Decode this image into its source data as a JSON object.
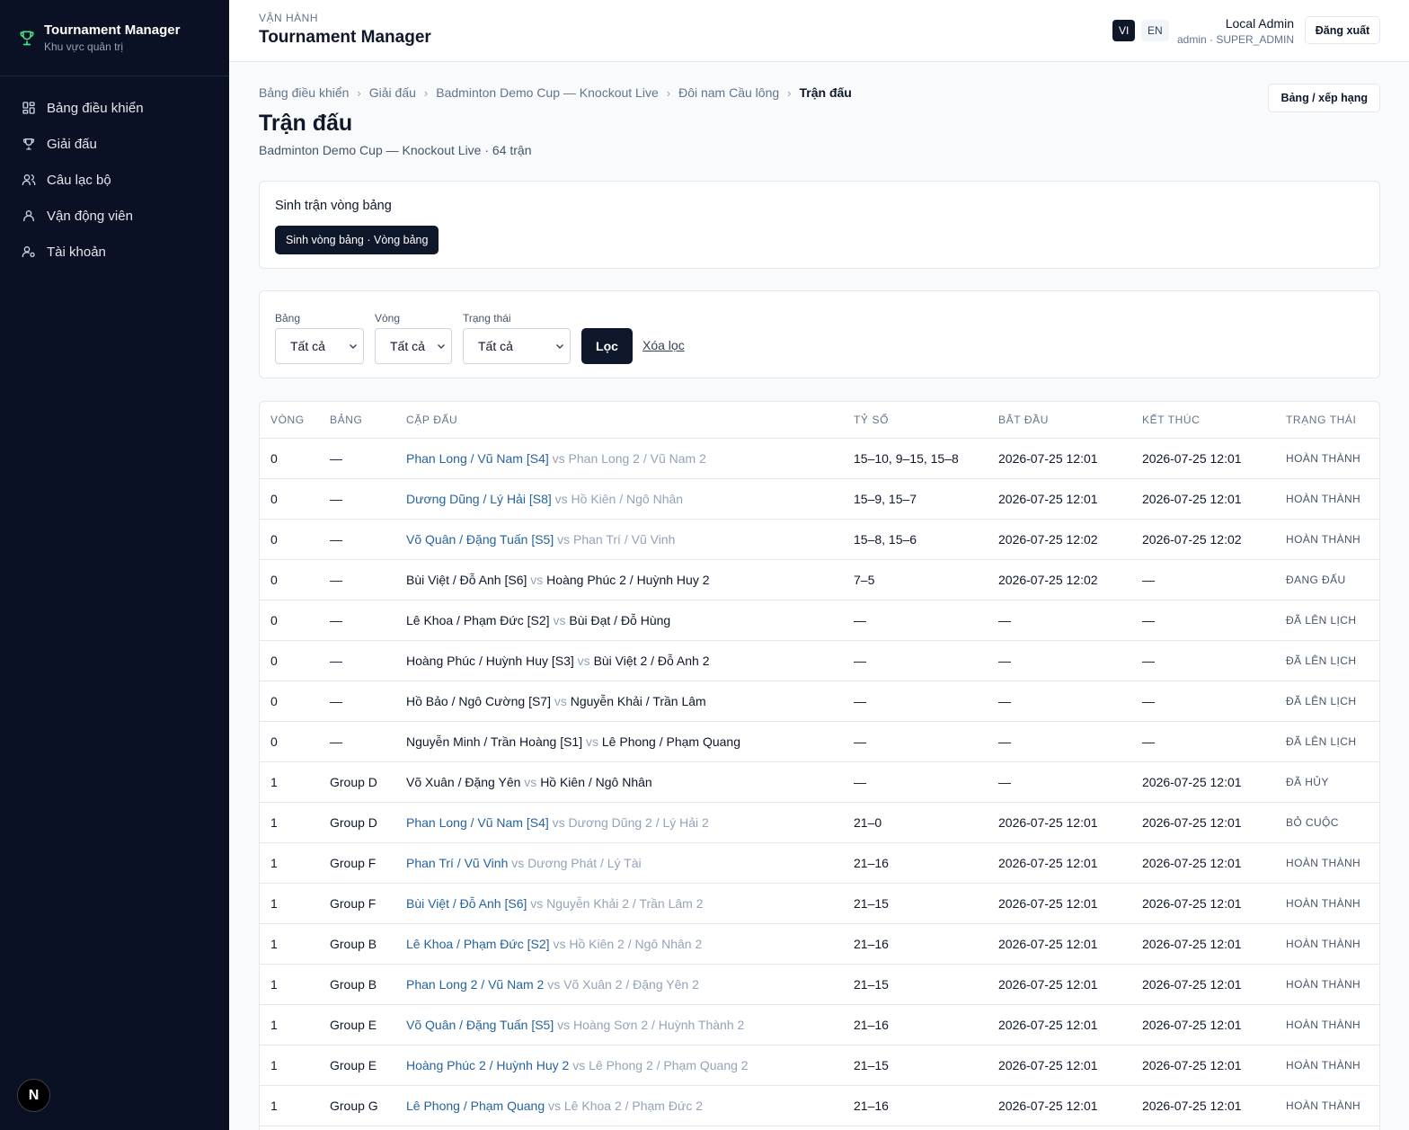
{
  "brand": {
    "title": "Tournament Manager",
    "subtitle": "Khu vực quản trị"
  },
  "nav": [
    {
      "label": "Bảng điều khiển",
      "icon": "dashboard-icon"
    },
    {
      "label": "Giải đấu",
      "icon": "trophy-icon"
    },
    {
      "label": "Câu lạc bộ",
      "icon": "users-icon"
    },
    {
      "label": "Vận động viên",
      "icon": "user-icon"
    },
    {
      "label": "Tài khoản",
      "icon": "user-cog-icon"
    }
  ],
  "header": {
    "eyebrow": "VẬN HÀNH",
    "title": "Tournament Manager",
    "lang_vi": "VI",
    "lang_en": "EN",
    "user_name": "Local Admin",
    "user_role": "admin · SUPER_ADMIN",
    "logout": "Đăng xuất"
  },
  "breadcrumb": [
    "Bảng điều khiển",
    "Giải đấu",
    "Badminton Demo Cup — Knockout Live",
    "Đôi nam Cầu lông",
    "Trận đấu"
  ],
  "page": {
    "title": "Trận đấu",
    "subtitle": "Badminton Demo Cup — Knockout Live · 64 trận",
    "ranking_button": "Bảng / xếp hạng"
  },
  "generate": {
    "title": "Sinh trận vòng bảng",
    "button": "Sinh vòng bảng · Vòng bảng"
  },
  "filters": {
    "group_label": "Bảng",
    "group_value": "Tất cả",
    "round_label": "Vòng",
    "round_value": "Tất cả",
    "status_label": "Trạng thái",
    "status_value": "Tất cả",
    "apply": "Lọc",
    "clear": "Xóa lọc"
  },
  "table": {
    "columns": [
      "VÒNG",
      "BẢNG",
      "CẶP ĐẤU",
      "TỶ SỐ",
      "BẮT ĐẦU",
      "KẾT THÚC",
      "TRẠNG THÁI"
    ],
    "vs": "vs",
    "rows": [
      {
        "round": "0",
        "group": "—",
        "a": "Phan Long / Vũ Nam [S4]",
        "b": "Phan Long 2 / Vũ Nam 2",
        "winner": "a",
        "score": "15–10, 9–15, 15–8",
        "start": "2026-07-25 12:01",
        "end": "2026-07-25 12:01",
        "status": "HOÀN THÀNH"
      },
      {
        "round": "0",
        "group": "—",
        "a": "Dương Dũng / Lý Hải [S8]",
        "b": "Hồ Kiên / Ngô Nhân",
        "winner": "a",
        "score": "15–9, 15–7",
        "start": "2026-07-25 12:01",
        "end": "2026-07-25 12:01",
        "status": "HOÀN THÀNH"
      },
      {
        "round": "0",
        "group": "—",
        "a": "Võ Quân / Đặng Tuấn [S5]",
        "b": "Phan Trí / Vũ Vinh",
        "winner": "a",
        "score": "15–8, 15–6",
        "start": "2026-07-25 12:02",
        "end": "2026-07-25 12:02",
        "status": "HOÀN THÀNH"
      },
      {
        "round": "0",
        "group": "—",
        "a": "Bùi Việt / Đỗ Anh [S6]",
        "b": "Hoàng Phúc 2 / Huỳnh Huy 2",
        "winner": "none",
        "score": "7–5",
        "start": "2026-07-25 12:02",
        "end": "—",
        "status": "ĐANG ĐẤU"
      },
      {
        "round": "0",
        "group": "—",
        "a": "Lê Khoa / Phạm Đức [S2]",
        "b": "Bùi Đạt / Đỗ Hùng",
        "winner": "none",
        "score": "—",
        "start": "—",
        "end": "—",
        "status": "ĐÃ LÊN LỊCH"
      },
      {
        "round": "0",
        "group": "—",
        "a": "Hoàng Phúc / Huỳnh Huy [S3]",
        "b": "Bùi Việt 2 / Đỗ Anh 2",
        "winner": "none",
        "score": "—",
        "start": "—",
        "end": "—",
        "status": "ĐÃ LÊN LỊCH"
      },
      {
        "round": "0",
        "group": "—",
        "a": "Hồ Bảo / Ngô Cường [S7]",
        "b": "Nguyễn Khải / Trần Lâm",
        "winner": "none",
        "score": "—",
        "start": "—",
        "end": "—",
        "status": "ĐÃ LÊN LỊCH"
      },
      {
        "round": "0",
        "group": "—",
        "a": "Nguyễn Minh / Trần Hoàng [S1]",
        "b": "Lê Phong / Phạm Quang",
        "winner": "none",
        "score": "—",
        "start": "—",
        "end": "—",
        "status": "ĐÃ LÊN LỊCH"
      },
      {
        "round": "1",
        "group": "Group D",
        "a": "Võ Xuân / Đặng Yên",
        "b": "Hồ Kiên / Ngô Nhân",
        "winner": "none",
        "score": "—",
        "start": "—",
        "end": "2026-07-25 12:01",
        "status": "ĐÃ HỦY"
      },
      {
        "round": "1",
        "group": "Group D",
        "a": "Phan Long / Vũ Nam [S4]",
        "b": "Dương Dũng 2 / Lý Hải 2",
        "winner": "a",
        "score": "21–0",
        "start": "2026-07-25 12:01",
        "end": "2026-07-25 12:01",
        "status": "BỎ CUỘC"
      },
      {
        "round": "1",
        "group": "Group F",
        "a": "Phan Trí / Vũ Vinh",
        "b": "Dương Phát / Lý Tài",
        "winner": "a",
        "score": "21–16",
        "start": "2026-07-25 12:01",
        "end": "2026-07-25 12:01",
        "status": "HOÀN THÀNH"
      },
      {
        "round": "1",
        "group": "Group F",
        "a": "Bùi Việt / Đỗ Anh [S6]",
        "b": "Nguyễn Khải 2 / Trần Lâm 2",
        "winner": "a",
        "score": "21–15",
        "start": "2026-07-25 12:01",
        "end": "2026-07-25 12:01",
        "status": "HOÀN THÀNH"
      },
      {
        "round": "1",
        "group": "Group B",
        "a": "Lê Khoa / Phạm Đức [S2]",
        "b": "Hồ Kiên 2 / Ngô Nhân 2",
        "winner": "a",
        "score": "21–16",
        "start": "2026-07-25 12:01",
        "end": "2026-07-25 12:01",
        "status": "HOÀN THÀNH"
      },
      {
        "round": "1",
        "group": "Group B",
        "a": "Phan Long 2 / Vũ Nam 2",
        "b": "Võ Xuân 2 / Đặng Yên 2",
        "winner": "a",
        "score": "21–15",
        "start": "2026-07-25 12:01",
        "end": "2026-07-25 12:01",
        "status": "HOÀN THÀNH"
      },
      {
        "round": "1",
        "group": "Group E",
        "a": "Võ Quân / Đặng Tuấn [S5]",
        "b": "Hoàng Sơn 2 / Huỳnh Thành 2",
        "winner": "a",
        "score": "21–16",
        "start": "2026-07-25 12:01",
        "end": "2026-07-25 12:01",
        "status": "HOÀN THÀNH"
      },
      {
        "round": "1",
        "group": "Group E",
        "a": "Hoàng Phúc 2 / Huỳnh Huy 2",
        "b": "Lê Phong 2 / Phạm Quang 2",
        "winner": "a",
        "score": "21–15",
        "start": "2026-07-25 12:01",
        "end": "2026-07-25 12:01",
        "status": "HOÀN THÀNH"
      },
      {
        "round": "1",
        "group": "Group G",
        "a": "Lê Phong / Phạm Quang",
        "b": "Lê Khoa 2 / Phạm Đức 2",
        "winner": "a",
        "score": "21–16",
        "start": "2026-07-25 12:01",
        "end": "2026-07-25 12:01",
        "status": "HOÀN THÀNH"
      }
    ]
  },
  "colors": {
    "sidebar": "#0b1124",
    "accent": "#0f172a",
    "winner": "#2563a0",
    "muted": "#94a3b8",
    "trophy": "#4ade80"
  }
}
